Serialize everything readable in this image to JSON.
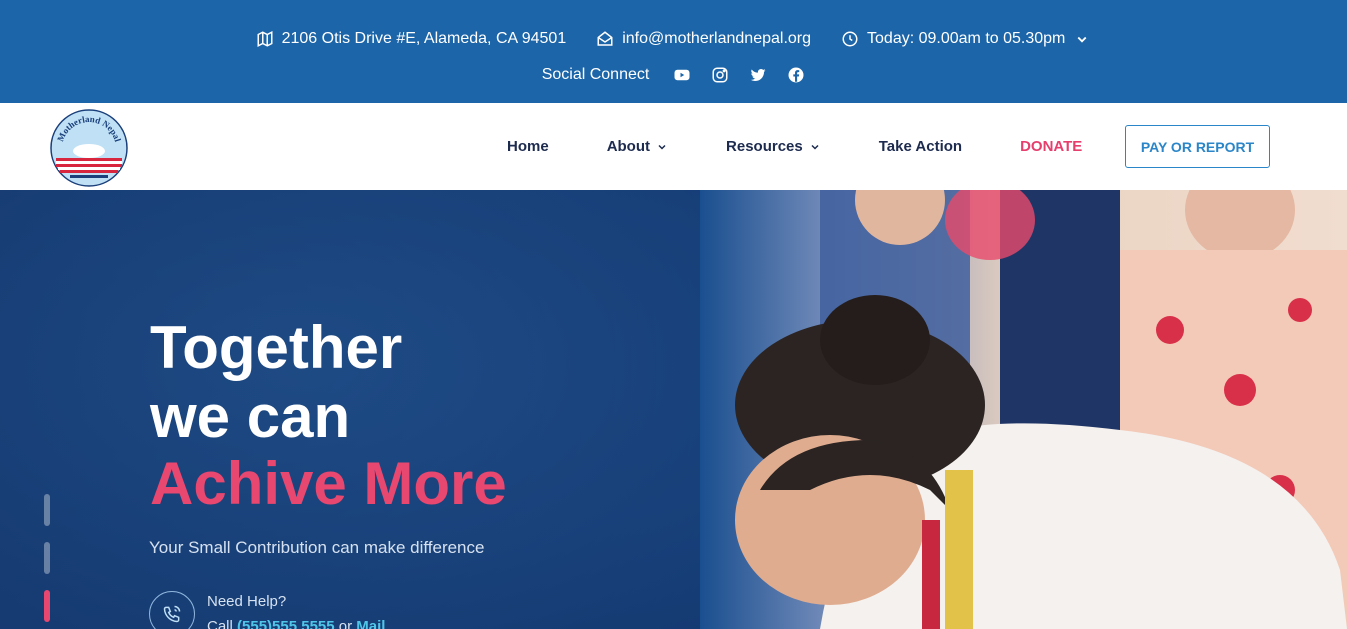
{
  "topbar": {
    "address": "2106 Otis Drive #E, Alameda, CA 94501",
    "email": "info@motherlandnepal.org",
    "hours": "Today: 09.00am to 05.30pm",
    "social_label": "Social Connect"
  },
  "logo": {
    "text": "Motherland Nepal"
  },
  "nav": {
    "items": [
      {
        "label": "Home"
      },
      {
        "label": "About"
      },
      {
        "label": "Resources"
      },
      {
        "label": "Take Action"
      },
      {
        "label": "DONATE"
      }
    ],
    "cta": "PAY OR REPORT"
  },
  "hero": {
    "line1": "Together",
    "line2": "we can",
    "line3": "Achive More",
    "subtitle": "Your Small Contribution can make difference",
    "help_title": "Need Help?",
    "help_prefix": "Call ",
    "help_phone": "(555)555 5555",
    "help_mid": " or ",
    "help_mail": "Mail"
  },
  "colors": {
    "topbar": "#1c65a8",
    "accent_pink": "#e8476f",
    "nav_text": "#1d2b4f",
    "cta_blue": "#2a86c8",
    "phone_link": "#4fc6e8"
  }
}
